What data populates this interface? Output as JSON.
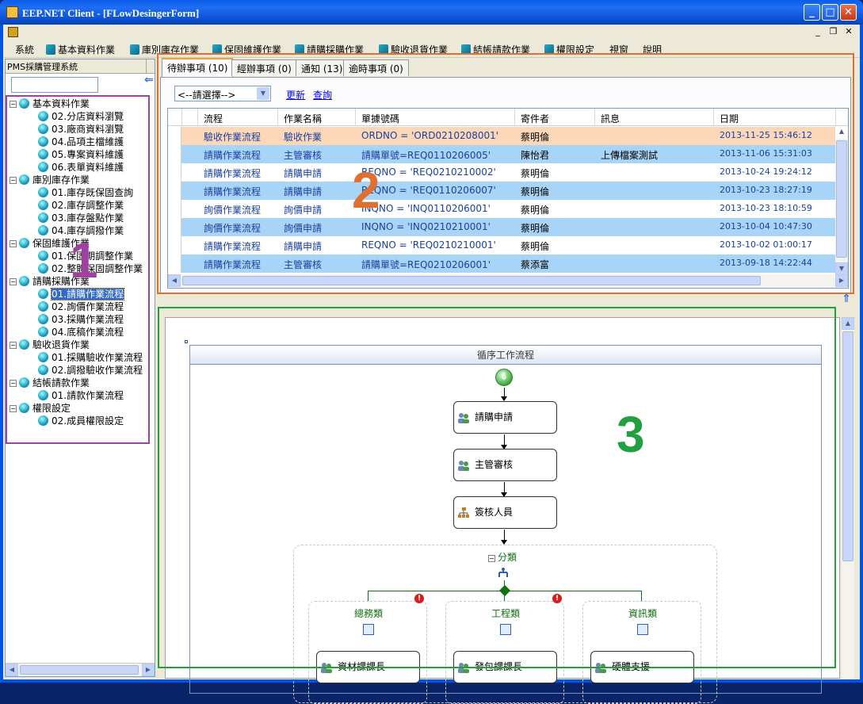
{
  "window": {
    "title": "EEP.NET Client - [FLowDesingerForm]",
    "controls": {
      "min": "_",
      "max": "□",
      "close": "✕"
    }
  },
  "mdi_controls": {
    "min": "_",
    "restore": "❐",
    "close": "✕"
  },
  "menu": [
    "系統",
    "基本資料作業",
    "庫別庫存作業",
    "保固維護作業",
    "請購採購作業",
    "驗收退貨作業",
    "結帳請款作業",
    "權限設定",
    "視窗",
    "說明"
  ],
  "left_panel": {
    "header": "PMS採購管理系統",
    "tree": [
      {
        "label": "基本資料作業",
        "level": 0
      },
      {
        "label": "02.分店資料瀏覽",
        "level": 1
      },
      {
        "label": "03.廠商資料瀏覽",
        "level": 1
      },
      {
        "label": "04.品項主檔維護",
        "level": 1
      },
      {
        "label": "05.專案資料維護",
        "level": 1
      },
      {
        "label": "06.表單資料維護",
        "level": 1
      },
      {
        "label": "庫別庫存作業",
        "level": 0
      },
      {
        "label": "01.庫存既保固查詢",
        "level": 1
      },
      {
        "label": "02.庫存調整作業",
        "level": 1
      },
      {
        "label": "03.庫存盤點作業",
        "level": 1
      },
      {
        "label": "04.庫存調撥作業",
        "level": 1
      },
      {
        "label": "保固維護作業",
        "level": 0
      },
      {
        "label": "01.保固期調整作業",
        "level": 1
      },
      {
        "label": "02.整體保固調整作業",
        "level": 1
      },
      {
        "label": "請購採購作業",
        "level": 0
      },
      {
        "label": "01.請購作業流程",
        "level": 1,
        "selected": true
      },
      {
        "label": "02.詢價作業流程",
        "level": 1
      },
      {
        "label": "03.採購作業流程",
        "level": 1
      },
      {
        "label": "04.底稿作業流程",
        "level": 1
      },
      {
        "label": "驗收退貨作業",
        "level": 0
      },
      {
        "label": "01.採購驗收作業流程",
        "level": 1
      },
      {
        "label": "02.調撥驗收作業流程",
        "level": 1
      },
      {
        "label": "結帳請款作業",
        "level": 0
      },
      {
        "label": "01.請款作業流程",
        "level": 1
      },
      {
        "label": "權限設定",
        "level": 0
      },
      {
        "label": "02.成員權限設定",
        "level": 1
      }
    ]
  },
  "tabs": [
    {
      "label": "待辦事項 (10)",
      "active": true
    },
    {
      "label": "經辦事項 (0)"
    },
    {
      "label": "通知 (13)"
    },
    {
      "label": "逾時事項 (0)"
    }
  ],
  "filter": {
    "select_value": "<--請選擇-->",
    "refresh": "更新",
    "query": "查詢"
  },
  "grid": {
    "columns": [
      "流程",
      "作業名稱",
      "單據號碼",
      "寄件者",
      "訊息",
      "日期"
    ],
    "rows": [
      {
        "flow": "驗收作業流程",
        "task": "驗收作業",
        "doc": "ORDNO = 'ORD0210208001'",
        "sender": "蔡明倫",
        "msg": "",
        "date": "2013-11-25 15:46:12",
        "style": "orange"
      },
      {
        "flow": "請購作業流程",
        "task": "主管審核",
        "doc": "請購單號=REQ0110206005'",
        "sender": "陳怡君",
        "msg": "上傳檔案測試",
        "date": "2013-11-06 15:31:03",
        "style": "blue"
      },
      {
        "flow": "請購作業流程",
        "task": "請購申請",
        "doc": "REQNO = 'REQ0210210002'",
        "sender": "蔡明倫",
        "msg": "",
        "date": "2013-10-24 19:24:12",
        "style": "white"
      },
      {
        "flow": "請購作業流程",
        "task": "請購申請",
        "doc": "REQNO = 'REQ0110206007'",
        "sender": "蔡明倫",
        "msg": "",
        "date": "2013-10-23 18:27:19",
        "style": "blue"
      },
      {
        "flow": "詢價作業流程",
        "task": "詢價申請",
        "doc": "INQNO = 'INQ0110206001'",
        "sender": "蔡明倫",
        "msg": "",
        "date": "2013-10-23 18:10:59",
        "style": "white"
      },
      {
        "flow": "詢價作業流程",
        "task": "詢價申請",
        "doc": "INQNO = 'INQ0210210001'",
        "sender": "蔡明倫",
        "msg": "",
        "date": "2013-10-04 10:47:30",
        "style": "blue"
      },
      {
        "flow": "請購作業流程",
        "task": "請購申請",
        "doc": "REQNO = 'REQ0210210001'",
        "sender": "蔡明倫",
        "msg": "",
        "date": "2013-10-02 01:00:17",
        "style": "white"
      },
      {
        "flow": "請購作業流程",
        "task": "主管審核",
        "doc": "請購單號=REQ0210206001'",
        "sender": "蔡添富",
        "msg": "",
        "date": "2013-09-18 14:22:44",
        "style": "blue"
      }
    ]
  },
  "flow": {
    "title": "循序工作流程",
    "steps": [
      "請購申請",
      "主管審核",
      "簽核人員"
    ],
    "parallel_label": "分類",
    "branches": [
      {
        "label": "總務類",
        "activity": "資材課課長"
      },
      {
        "label": "工程類",
        "activity": "發包課課長"
      },
      {
        "label": "資訊類",
        "activity": "硬體支援"
      }
    ]
  },
  "annotations": [
    "1",
    "2",
    "3"
  ],
  "colors": {
    "ann1": "#a040a0",
    "ann2": "#e07030",
    "ann3": "#20a040",
    "row_orange": "#fcd8b8",
    "row_blue": "#a8d4f8",
    "link": "#0000ee",
    "flow_green": "#107010"
  }
}
